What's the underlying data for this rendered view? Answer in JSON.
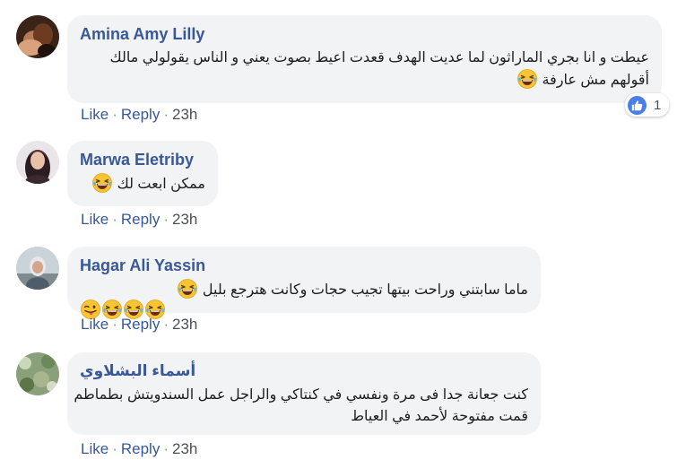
{
  "actions": {
    "like_label": "Like",
    "reply_label": "Reply",
    "separator": "·"
  },
  "comments": [
    {
      "author": "Amina Amy Lilly",
      "lines": [
        "عيطت و انا بجري الماراثون لما عديت الهدف قعدت اعيط بصوت يعني و الناس يقولولي مالك",
        "أقولهم مش عارفة"
      ],
      "emojis": [
        "laughing-tears-emoji"
      ],
      "time": "23h",
      "reaction_count": "1",
      "reaction_icon": "like-thumb-icon"
    },
    {
      "author": "Marwa Eletriby",
      "lines": [
        "ممكن ابعت لك"
      ],
      "emojis": [
        "laughing-tears-emoji"
      ],
      "time": "23h"
    },
    {
      "author": "Hagar Ali Yassin",
      "lines": [
        "ماما سابتني وراحت بيتها تجيب حجات وكانت هترجع بليل"
      ],
      "emojis": [
        "laughing-tears-emoji",
        "laughing-tears-emoji",
        "laughing-tears-emoji",
        "laughing-tears-emoji",
        "winking-tongue-emoji"
      ],
      "time": "23h"
    },
    {
      "author": "أسماء البشلاوي",
      "lines": [
        "كنت جعانة جدا فى مرة ونفسي في كنتاكي والراجل عمل السندويتش بطماطم",
        "قمت مفتوحة لأحمد في العياط"
      ],
      "time": "23h"
    }
  ],
  "colors": {
    "author": "#385898",
    "bubble": "#f2f3f5",
    "text": "#1c1e21",
    "like_badge": "#4a7ee8"
  }
}
